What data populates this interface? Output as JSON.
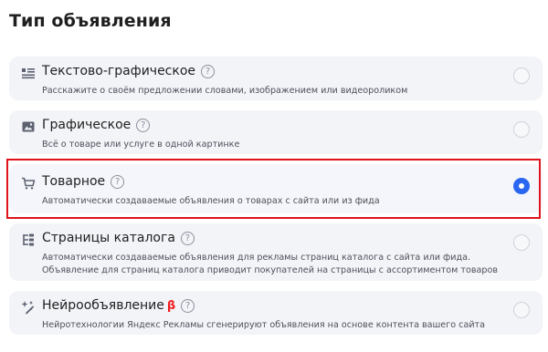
{
  "page": {
    "title": "Тип объявления"
  },
  "options": [
    {
      "icon": "text-image-icon",
      "title": "Текстово-графическое",
      "beta": "",
      "description": "Расскажите о своём предложении словами, изображением или видеороликом",
      "selected": false
    },
    {
      "icon": "image-icon",
      "title": "Графическое",
      "beta": "",
      "description": "Всё о товаре или услуге в одной картинке",
      "selected": false
    },
    {
      "icon": "cart-icon",
      "title": "Товарное",
      "beta": "",
      "description": "Автоматически создаваемые объявления о товарах с сайта или из фида",
      "selected": true
    },
    {
      "icon": "catalog-icon",
      "title": "Страницы каталога",
      "beta": "",
      "description": "Автоматически создаваемые объявления для рекламы страниц каталога с сайта или фида. Объявление для страниц каталога приводит покупателей на страницы с ассортиментом товаров",
      "selected": false
    },
    {
      "icon": "sparkle-icon",
      "title": "Нейрообъявление",
      "beta": "β",
      "description": "Нейротехнологии Яндекс Рекламы сгенерируют объявления на основе контента вашего сайта",
      "selected": false
    }
  ],
  "help_glyph": "?",
  "colors": {
    "card_bg": "#f3f4f8",
    "radio_selected": "#2a66f0",
    "highlight": "#e0121c",
    "beta": "#ef1c1c"
  }
}
